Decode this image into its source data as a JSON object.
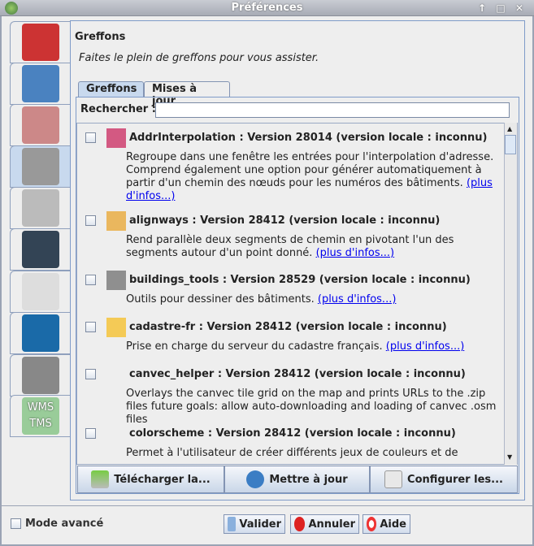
{
  "window": {
    "title": "Préférences",
    "buttons": [
      "↑",
      "□",
      "✕"
    ]
  },
  "sidebar": {
    "tabs": [
      {
        "name": "display-preferences",
        "color": "#c33"
      },
      {
        "name": "connection-preferences",
        "color": "#4a82c0"
      },
      {
        "name": "projection-preferences",
        "color": "#c88"
      },
      {
        "name": "plugin-preferences",
        "color": "#999",
        "selected": true
      },
      {
        "name": "map-preferences",
        "color": "#bbb"
      },
      {
        "name": "audio-preferences",
        "color": "#345"
      },
      {
        "name": "shortcut-preferences",
        "color": "#ddd"
      },
      {
        "name": "validator-preferences",
        "color": "#1a6aa8"
      },
      {
        "name": "remote-control-preferences",
        "color": "#888"
      },
      {
        "name": "imagery-preferences",
        "color": "#9c9",
        "label": "WMS TMS"
      }
    ]
  },
  "main": {
    "heading": "Greffons",
    "subtitle": "Faites le plein de greffons pour vous assister.",
    "tabs": [
      {
        "label": "Greffons",
        "selected": true
      },
      {
        "label": "Mises à jour"
      }
    ],
    "search": {
      "label": "Rechercher :",
      "value": ""
    },
    "plugins": [
      {
        "title": "AddrInterpolation : Version 28014 (version locale : inconnu)",
        "desc": "Regroupe dans une fenêtre les entrées pour l'interpolation d'adresse. Comprend également une option pour générer automatiquement à partir d'un chemin des nœuds pour les numéros des bâtiments.",
        "link": "(plus d'infos...)",
        "icon": "#c36"
      },
      {
        "title": "alignways : Version 28412 (version locale : inconnu)",
        "desc": "Rend parallèle deux segments de chemin en pivotant l'un des segments autour d'un point donné.",
        "link": "(plus d'infos...)",
        "icon": "#e9a93a"
      },
      {
        "title": "buildings_tools : Version 28529 (version locale : inconnu)",
        "desc": "Outils pour dessiner des bâtiments.",
        "link": "(plus d'infos...)",
        "icon": "#777"
      },
      {
        "title": "cadastre-fr : Version 28412 (version locale : inconnu)",
        "desc": "Prise en charge du serveur du cadastre français.",
        "link": "(plus d'infos...)",
        "icon": "#f5c030"
      },
      {
        "title": "canvec_helper : Version 28412 (version locale : inconnu)",
        "desc": "Overlays the canvec tile grid on the map and prints URLs to the .zip files future goals: allow auto-downloading and loading of canvec .osm files",
        "link": "",
        "icon": ""
      },
      {
        "title": "colorscheme : Version 28412 (version locale : inconnu)",
        "desc": "Permet à l'utilisateur de créer différents jeux de couleurs et de",
        "link": "",
        "icon": ""
      }
    ],
    "buttons": {
      "download": "Télécharger la...",
      "update": "Mettre à jour",
      "configure": "Configurer les..."
    }
  },
  "footer": {
    "mode_label": "Mode avancé",
    "ok": "Valider",
    "cancel": "Annuler",
    "help": "Aide"
  }
}
